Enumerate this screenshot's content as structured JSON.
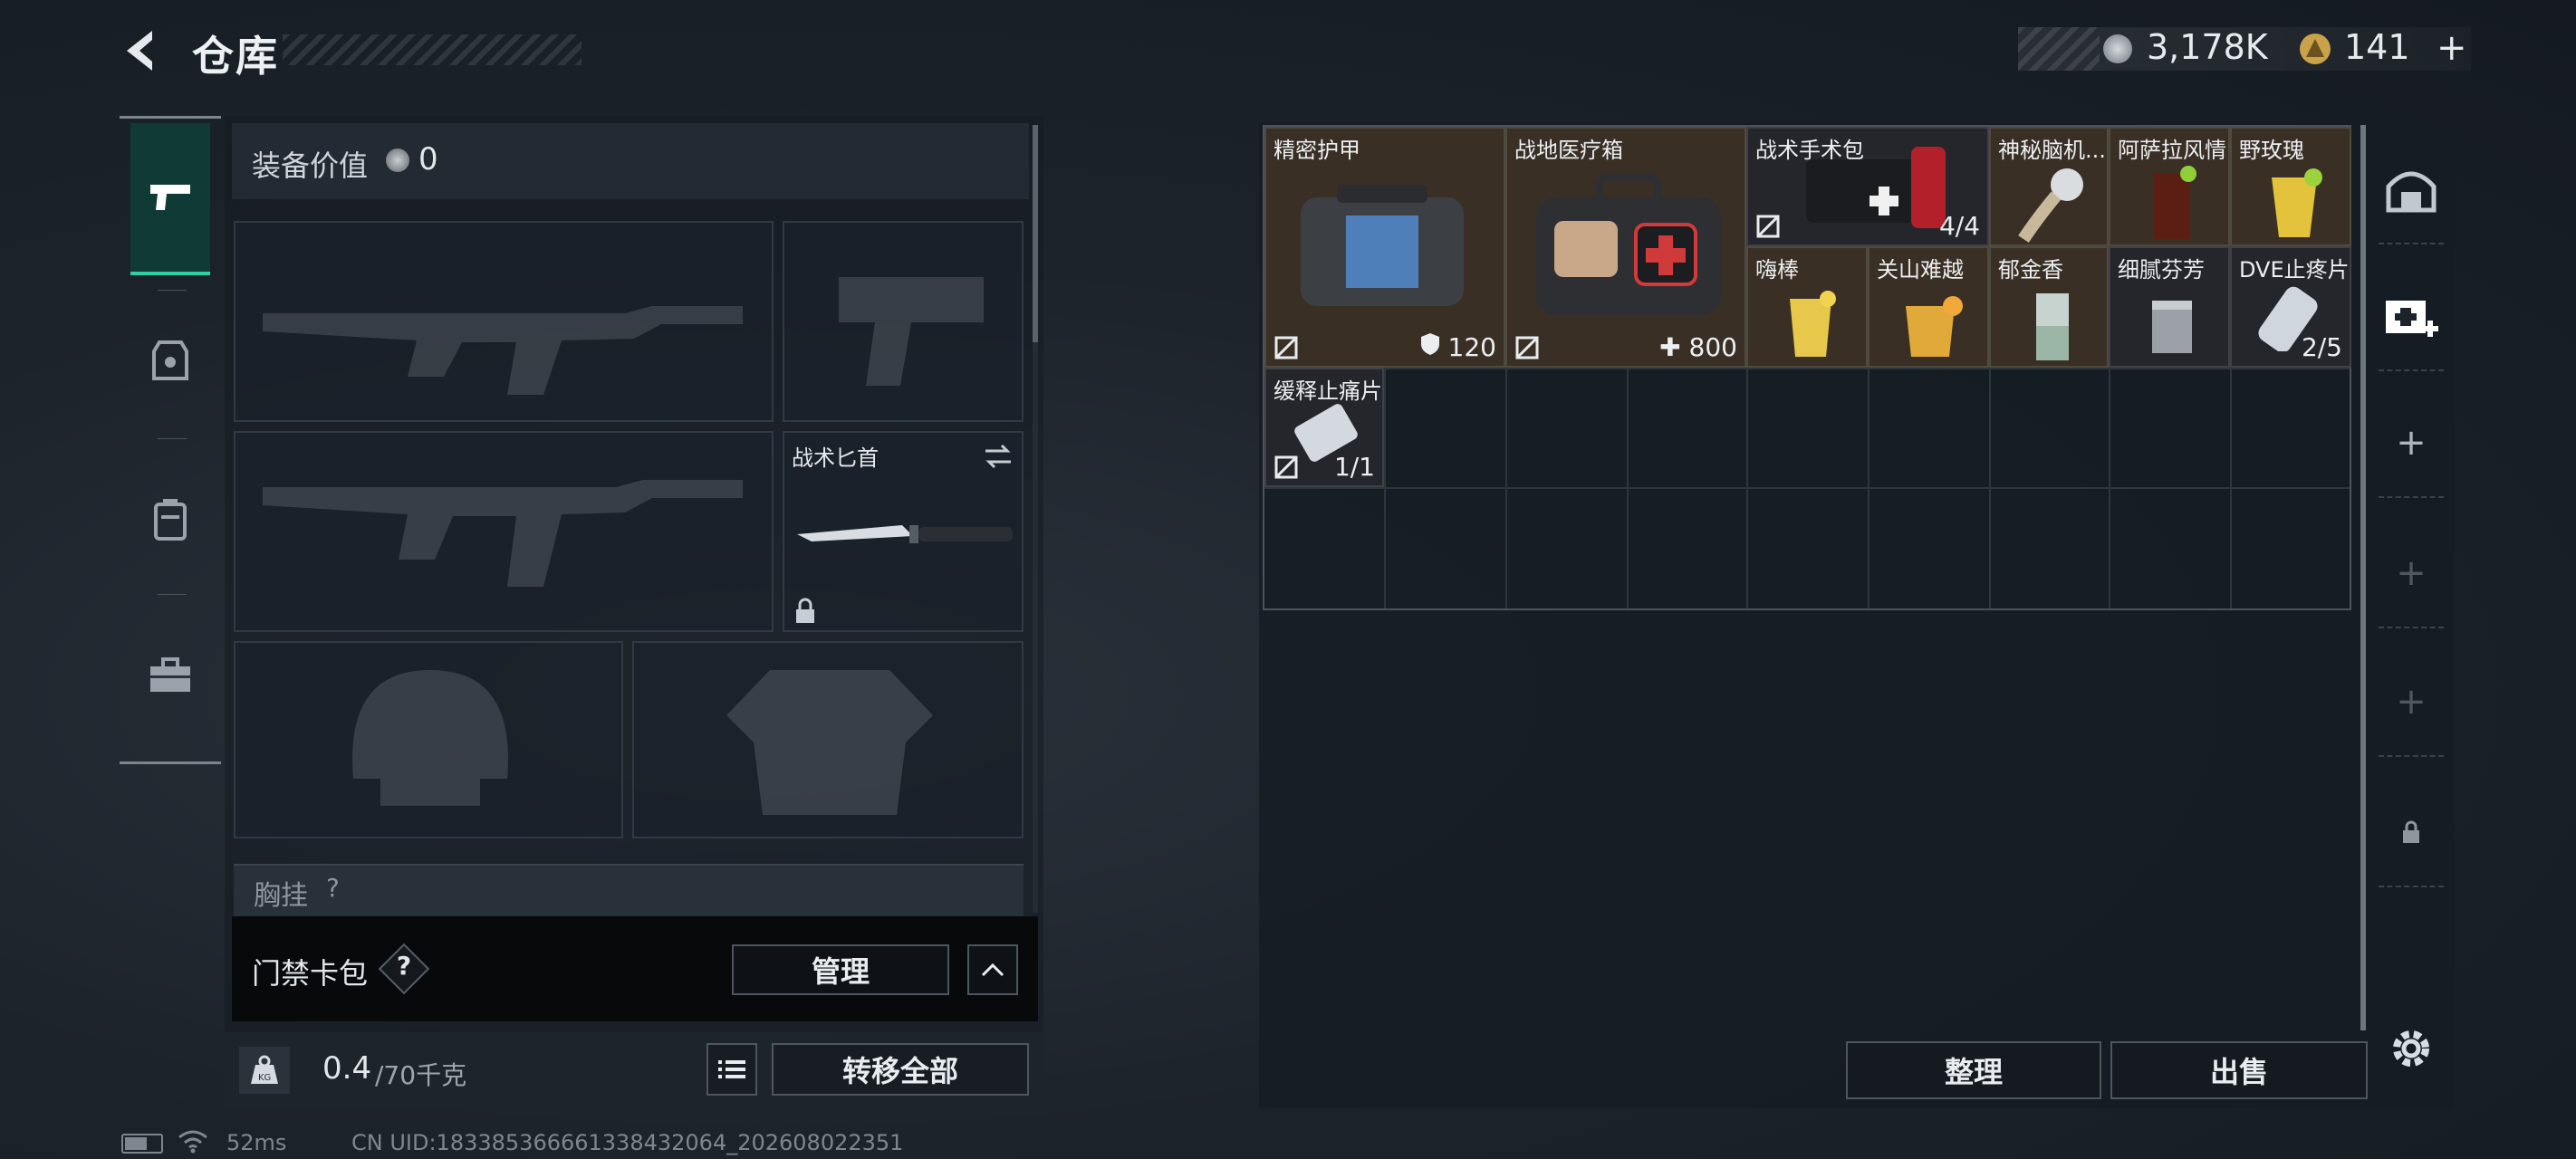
{
  "header": {
    "title": "仓库"
  },
  "currency": {
    "coins": "3,178K",
    "tickets": "141"
  },
  "equipment": {
    "value_label": "装备价值",
    "value": "0",
    "knife_slot": "战术匕首",
    "chest_rig_label": "胸挂",
    "chest_rig_hint": "?"
  },
  "card_pack": {
    "label": "门禁卡包",
    "help": "?",
    "manage_label": "管理"
  },
  "weight": {
    "current": "0.4",
    "max": "/70千克",
    "transfer_label": "转移全部"
  },
  "storage": {
    "items": [
      {
        "name": "精密护甲",
        "value": "120"
      },
      {
        "name": "战地医疗箱",
        "value": "800"
      },
      {
        "name": "战术手术包",
        "value": "4/4"
      },
      {
        "name": "神秘脑机..."
      },
      {
        "name": "阿萨拉风情"
      },
      {
        "name": "野玫瑰"
      },
      {
        "name": "嗨棒"
      },
      {
        "name": "关山难越"
      },
      {
        "name": "郁金香"
      },
      {
        "name": "细腻芬芳"
      },
      {
        "name": "DVE止疼片",
        "value": "2/5"
      },
      {
        "name": "缓释止痛片",
        "value": "1/1"
      }
    ],
    "sort_label": "整理",
    "sell_label": "出售"
  },
  "status": {
    "latency": "52ms",
    "uid": "CN UID:183385366661338432064_202608022351"
  },
  "colors": {
    "accent": "#2fd0a2",
    "item_bg": "#3a2f25",
    "panel": "#151c23"
  }
}
